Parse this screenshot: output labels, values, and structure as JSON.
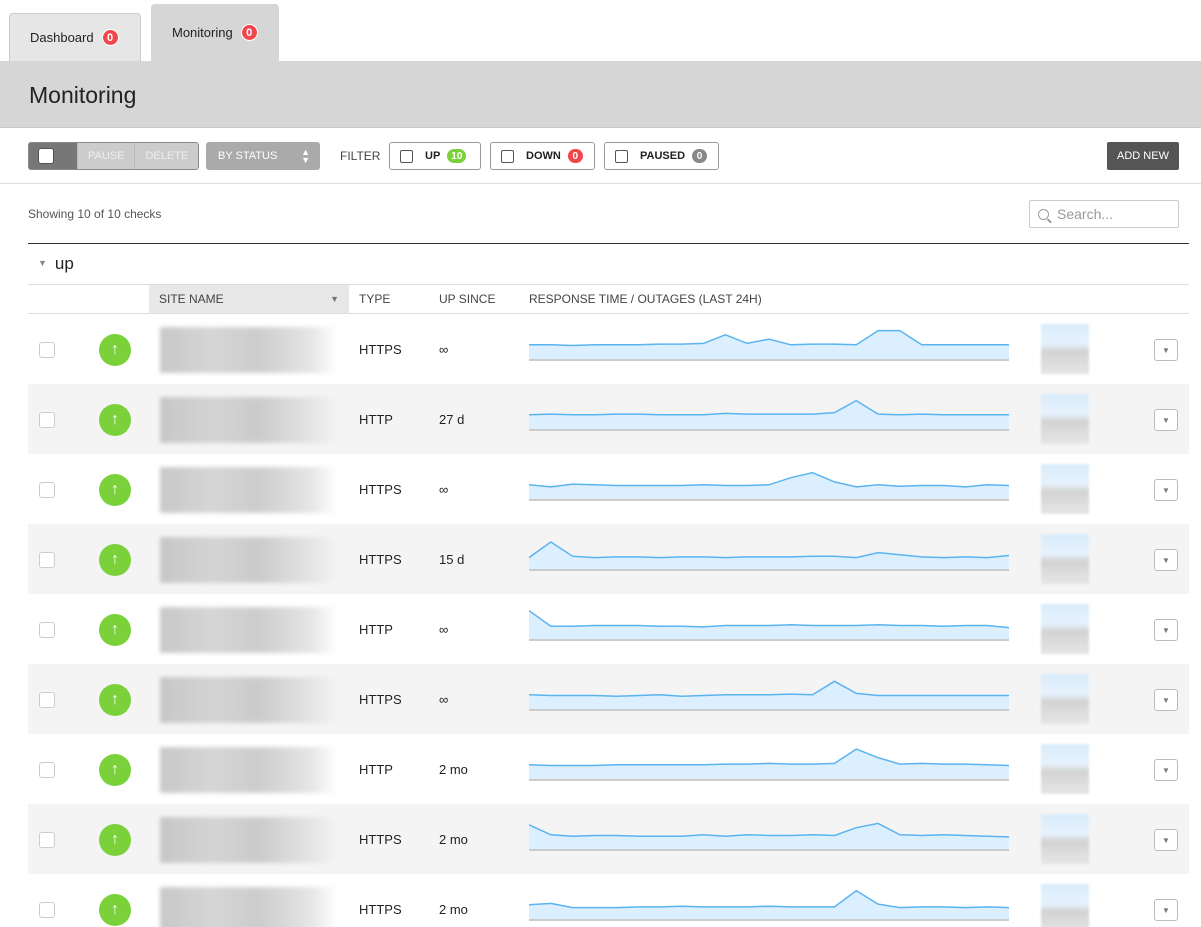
{
  "tabs": [
    {
      "label": "Dashboard",
      "badge": "0"
    },
    {
      "label": "Monitoring",
      "badge": "0"
    }
  ],
  "header": {
    "title": "Monitoring"
  },
  "toolbar": {
    "pause_label": "PAUSE",
    "delete_label": "DELETE",
    "sort_label": "BY STATUS",
    "filter_label": "FILTER",
    "filters": [
      {
        "label": "UP",
        "count": "10",
        "color": "#7bd13a"
      },
      {
        "label": "DOWN",
        "count": "0",
        "color": "#f0474e"
      },
      {
        "label": "PAUSED",
        "count": "0",
        "color": "#888888"
      }
    ],
    "add_new_label": "ADD NEW"
  },
  "status": {
    "showing": "Showing 10 of 10 checks"
  },
  "search": {
    "placeholder": "Search..."
  },
  "group": {
    "title": "up"
  },
  "columns": {
    "site_name": "SITE NAME",
    "type": "TYPE",
    "up_since": "UP SINCE",
    "response": "RESPONSE TIME / OUTAGES (LAST 24H)"
  },
  "rows": [
    {
      "type": "HTTPS",
      "since": "∞",
      "spark": [
        20,
        20,
        19,
        20,
        20,
        20,
        21,
        21,
        22,
        34,
        22,
        28,
        20,
        21,
        21,
        20,
        40,
        40,
        20,
        20,
        20,
        20,
        20
      ]
    },
    {
      "type": "HTTP",
      "since": "27 d",
      "spark": [
        20,
        21,
        20,
        20,
        21,
        21,
        20,
        20,
        20,
        22,
        21,
        21,
        21,
        21,
        23,
        40,
        21,
        20,
        21,
        20,
        20,
        20,
        20
      ]
    },
    {
      "type": "HTTPS",
      "since": "∞",
      "spark": [
        20,
        17,
        21,
        20,
        19,
        19,
        19,
        19,
        20,
        19,
        19,
        20,
        30,
        37,
        24,
        17,
        20,
        18,
        19,
        19,
        17,
        20,
        19
      ]
    },
    {
      "type": "HTTPS",
      "since": "15 d",
      "spark": [
        16,
        38,
        18,
        16,
        17,
        17,
        16,
        17,
        17,
        16,
        17,
        17,
        17,
        18,
        18,
        16,
        23,
        20,
        17,
        16,
        17,
        16,
        19
      ]
    },
    {
      "type": "HTTP",
      "since": "∞",
      "spark": [
        40,
        18,
        18,
        19,
        19,
        19,
        18,
        18,
        17,
        19,
        19,
        19,
        20,
        19,
        19,
        19,
        20,
        19,
        19,
        18,
        19,
        19,
        16
      ]
    },
    {
      "type": "HTTPS",
      "since": "∞",
      "spark": [
        20,
        19,
        19,
        19,
        18,
        19,
        20,
        18,
        19,
        20,
        20,
        20,
        21,
        20,
        39,
        22,
        19,
        19,
        19,
        19,
        19,
        19,
        19
      ]
    },
    {
      "type": "HTTP",
      "since": "2 mo",
      "spark": [
        20,
        19,
        19,
        19,
        20,
        20,
        20,
        20,
        20,
        21,
        21,
        22,
        21,
        21,
        22,
        42,
        30,
        21,
        22,
        21,
        21,
        20,
        19
      ]
    },
    {
      "type": "HTTPS",
      "since": "2 mo",
      "spark": [
        34,
        20,
        18,
        19,
        19,
        18,
        18,
        18,
        20,
        18,
        20,
        19,
        19,
        20,
        19,
        30,
        36,
        20,
        19,
        20,
        19,
        18,
        17
      ]
    },
    {
      "type": "HTTPS",
      "since": "2 mo",
      "spark": [
        20,
        22,
        16,
        16,
        16,
        17,
        17,
        18,
        17,
        17,
        17,
        18,
        17,
        17,
        17,
        40,
        21,
        16,
        17,
        17,
        16,
        17,
        16
      ]
    }
  ]
}
